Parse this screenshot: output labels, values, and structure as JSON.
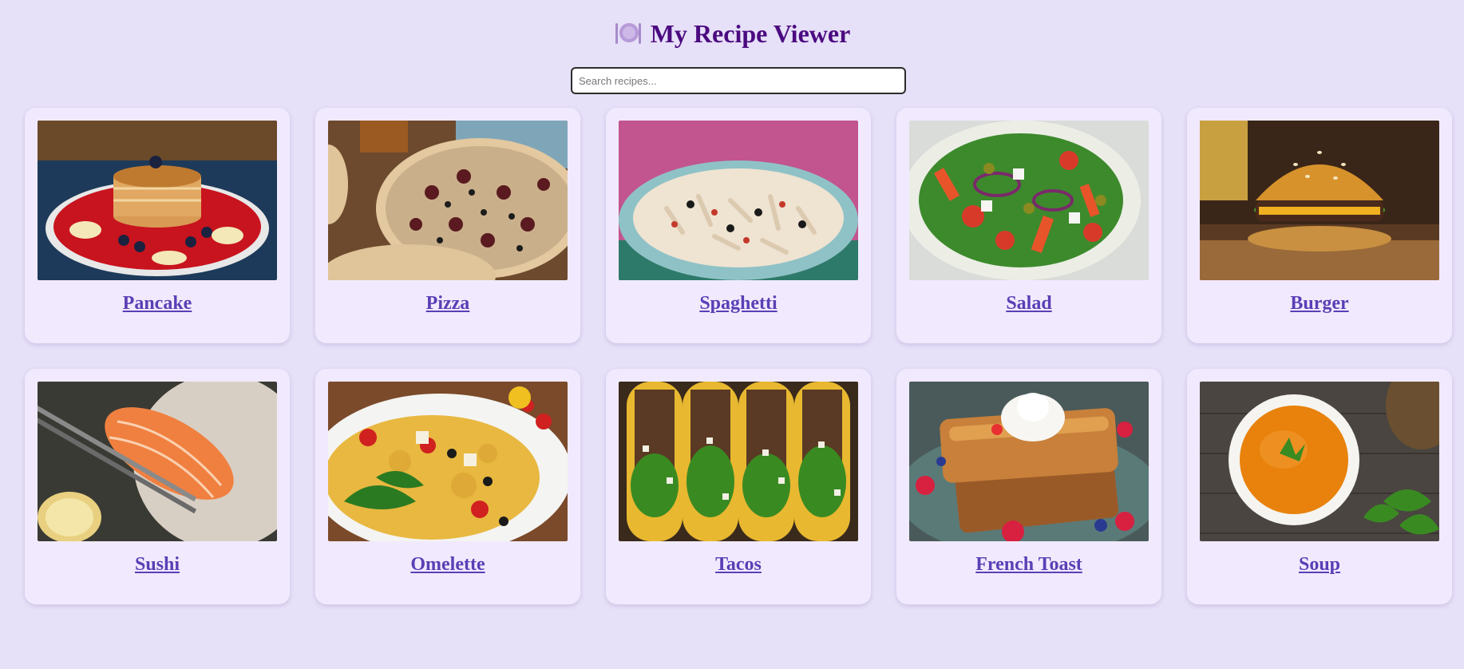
{
  "header": {
    "icon": "plate-with-cutlery-icon",
    "title": "My Recipe Viewer"
  },
  "search": {
    "placeholder": "Search recipes...",
    "value": ""
  },
  "recipes": [
    {
      "name": "Pancake",
      "icon": "pancake-photo"
    },
    {
      "name": "Pizza",
      "icon": "pizza-photo"
    },
    {
      "name": "Spaghetti",
      "icon": "spaghetti-photo"
    },
    {
      "name": "Salad",
      "icon": "salad-photo"
    },
    {
      "name": "Burger",
      "icon": "burger-photo"
    },
    {
      "name": "Sushi",
      "icon": "sushi-photo"
    },
    {
      "name": "Omelette",
      "icon": "omelette-photo"
    },
    {
      "name": "Tacos",
      "icon": "tacos-photo"
    },
    {
      "name": "French Toast",
      "icon": "french-toast-photo"
    },
    {
      "name": "Soup",
      "icon": "soup-photo"
    }
  ],
  "colors": {
    "background": "#e6e0f8",
    "card": "#f1eaff",
    "title": "#4b0a80",
    "link": "#5a3fb5"
  }
}
